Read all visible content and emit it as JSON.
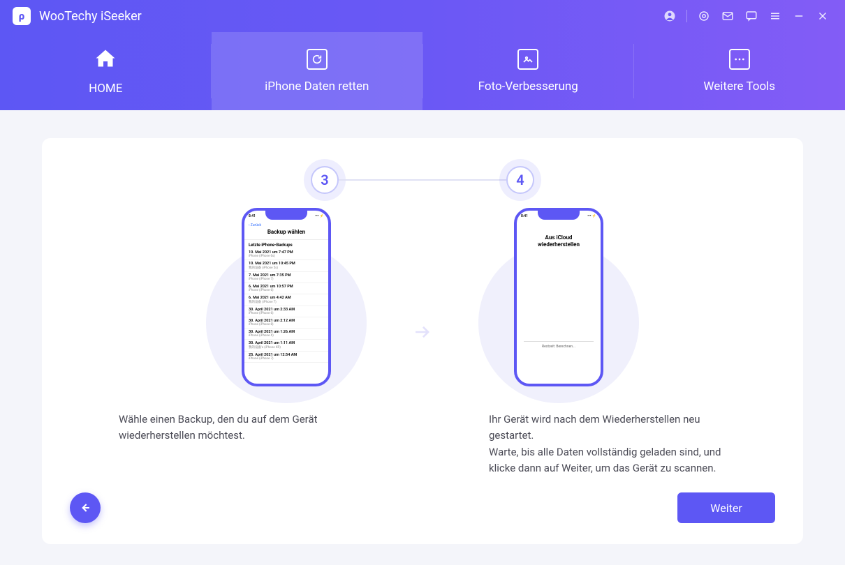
{
  "app": {
    "title": "WooTechy iSeeker",
    "logo_glyph": "ρ"
  },
  "titlebar_icons": [
    "account-icon",
    "target-icon",
    "mail-icon",
    "chat-icon",
    "menu-icon",
    "minimize-icon",
    "close-icon"
  ],
  "tabs": {
    "home": "HOME",
    "recover": "iPhone Daten retten",
    "photo": "Foto-Verbesserung",
    "more": "Weitere Tools"
  },
  "steps": {
    "num3": "3",
    "num4": "4"
  },
  "phone1": {
    "time": "8:41",
    "back": "Zurück",
    "title": "Backup wählen",
    "subtitle": "Letzte iPhone-Backups",
    "rows": [
      {
        "t1": "10. Mai 2021 um 7:47 PM",
        "t2": "iPhone (iPhone 6s)"
      },
      {
        "t1": "10. Mai 2021 um 10:45 PM",
        "t2": "我的设备 (iPhone 5s)"
      },
      {
        "t1": "7. Mai 2021 um 7:35 PM",
        "t2": "iPhone (iPhone 7)"
      },
      {
        "t1": "6. Mai 2021 um 10:57 PM",
        "t2": "iPhone (iPhone 6)"
      },
      {
        "t1": "6. Mai 2021 um 4:42 AM",
        "t2": "我的设备 (iPhone 7)"
      },
      {
        "t1": "30. April 2021 um 2:33 AM",
        "t2": "iPhone (iPhone 6)"
      },
      {
        "t1": "30. April 2021 um 2:12 AM",
        "t2": "iPhone (iPhone 8)"
      },
      {
        "t1": "30. April 2021 um 1:26 AM",
        "t2": "iPhone (iPhone X)"
      },
      {
        "t1": "30. April 2021 um 1:11 AM",
        "t2": "我的设备's (iPhone XR)"
      },
      {
        "t1": "25. April 2021 um 12:54 AM",
        "t2": "iPhone (iPhone 7)"
      }
    ]
  },
  "phone2": {
    "time": "8:41",
    "title_l1": "Aus iCloud",
    "title_l2": "wiederherstellen",
    "progress": "Restzeit: Berechnen..."
  },
  "captions": {
    "c1": "Wähle einen Backup, den du auf dem Gerät wiederherstellen möchtest.",
    "c2": "Ihr Gerät wird nach dem Wiederherstellen neu gestartet.\nWarte, bis alle Daten vollständig geladen sind, und klicke dann auf Weiter, um das Gerät zu scannen."
  },
  "buttons": {
    "next": "Weiter"
  }
}
